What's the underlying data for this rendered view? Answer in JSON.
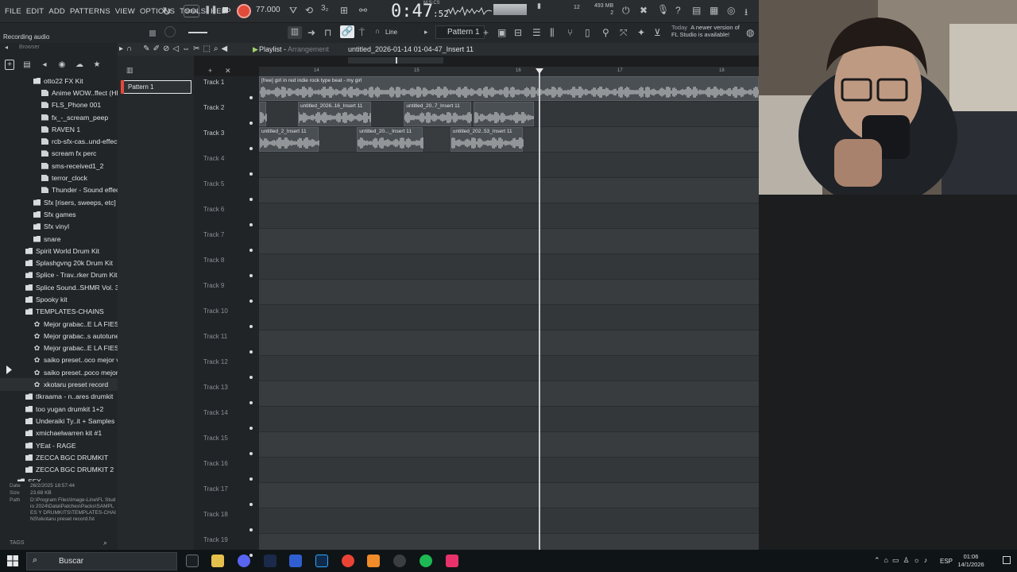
{
  "menu": [
    "FILE",
    "EDIT",
    "ADD",
    "PATTERNS",
    "VIEW",
    "OPTIONS",
    "TOOLS",
    "HELP"
  ],
  "transport": {
    "song_label": "SONG",
    "bpm": "77.000",
    "time": "0:47",
    "time_sub": ":52",
    "time_unit": "M:S:CS"
  },
  "meters": {
    "cpu": "12",
    "memory": "493 MB",
    "memory_sub": "2"
  },
  "toolbar": {
    "recording_label": "Recording audio",
    "snap_label": "Line",
    "pattern_select": "Pattern 1"
  },
  "news": {
    "prefix": "Today",
    "text_line1": "A newer version of",
    "text_line2": "FL Studio is available!"
  },
  "browser": {
    "header": "Browser",
    "items": [
      {
        "label": "otto22 FX Kit",
        "type": "folder",
        "indent": 2
      },
      {
        "label": "Anime WOW..ffect (HD)",
        "type": "file",
        "indent": 3
      },
      {
        "label": "FLS_Phone 001",
        "type": "file",
        "indent": 3
      },
      {
        "label": "fx_-_scream_peep",
        "type": "file",
        "indent": 3
      },
      {
        "label": "RAVEN 1",
        "type": "file",
        "indent": 3
      },
      {
        "label": "rcb-sfx-cas..und-effects",
        "type": "file",
        "indent": 3
      },
      {
        "label": "scream fx perc",
        "type": "file",
        "indent": 3
      },
      {
        "label": "sms-received1_2",
        "type": "file",
        "indent": 3
      },
      {
        "label": "terror_clock",
        "type": "file",
        "indent": 3
      },
      {
        "label": "Thunder - Sound effect",
        "type": "file",
        "indent": 3
      },
      {
        "label": "Sfx [risers, sweeps, etc]",
        "type": "folder",
        "indent": 2
      },
      {
        "label": "Sfx games",
        "type": "folder",
        "indent": 2
      },
      {
        "label": "Sfx vinyl",
        "type": "folder",
        "indent": 2
      },
      {
        "label": "snare",
        "type": "folder",
        "indent": 2
      },
      {
        "label": "Spirit World Drum Kit",
        "type": "folder",
        "indent": 1
      },
      {
        "label": "Splashgvng 20k Drum Kit",
        "type": "folder",
        "indent": 1
      },
      {
        "label": "Splice - Trav..rker Drum Kit",
        "type": "folder",
        "indent": 1
      },
      {
        "label": "Splice Sound..SHMR Vol. 3",
        "type": "folder",
        "indent": 1
      },
      {
        "label": "Spooky kit",
        "type": "folder",
        "indent": 1
      },
      {
        "label": "TEMPLATES-CHAINS",
        "type": "folder",
        "indent": 1
      },
      {
        "label": "Mejor grabac..E LA FIESTA",
        "type": "gear",
        "indent": 2
      },
      {
        "label": "Mejor grabac..s autotune)",
        "type": "gear",
        "indent": 2
      },
      {
        "label": "Mejor grabac..E LA FIESTA",
        "type": "gear",
        "indent": 2
      },
      {
        "label": "saiko preset..oco mejor v2",
        "type": "gear",
        "indent": 2
      },
      {
        "label": "saiko preset..poco mejor",
        "type": "gear",
        "indent": 2
      },
      {
        "label": "xkotaru preset record",
        "type": "gear",
        "indent": 2,
        "selected": true
      },
      {
        "label": "tlkraama - n..ares drumkit",
        "type": "folder",
        "indent": 1
      },
      {
        "label": "too yugan drumkit 1+2",
        "type": "folder",
        "indent": 1
      },
      {
        "label": "Underaiki Ty..it + Samples",
        "type": "folder",
        "indent": 1
      },
      {
        "label": "xmichaelwarren kit #1",
        "type": "folder",
        "indent": 1
      },
      {
        "label": "YEat - RAGE",
        "type": "folder",
        "indent": 1
      },
      {
        "label": "ZECCA BGC DRUMKIT",
        "type": "folder",
        "indent": 1
      },
      {
        "label": "ZECCA BGC DRUMKIT 2",
        "type": "folder",
        "indent": 1
      },
      {
        "label": "SFX",
        "type": "folder",
        "indent": 0
      },
      {
        "label": "Shapes",
        "type": "folder",
        "indent": 0
      }
    ],
    "info": {
      "date_key": "Date",
      "date": "26/2/2025 18:57:44",
      "size_key": "Size",
      "size": "23.68 KB",
      "path_key": "Path",
      "path": "D:\\Program Files\\Image-Line\\FL Studio 2024\\Data\\Patches\\Packs\\SAMPLES Y DRUMKITS\\TEMPLATES-CHAINS\\xkotaru preset record.fst"
    },
    "tags_label": "TAGS"
  },
  "playlist": {
    "title": "Playlist",
    "subtitle": "Arrangement",
    "file": "untitled_2026-01-14 01-04-47_Insert 11",
    "pattern": "Pattern 1",
    "ruler": [
      "14",
      "15",
      "16",
      "17",
      "18"
    ],
    "tracks": [
      "Track 1",
      "Track 2",
      "Track 3",
      "Track 4",
      "Track 5",
      "Track 6",
      "Track 7",
      "Track 8",
      "Track 9",
      "Track 10",
      "Track 11",
      "Track 12",
      "Track 13",
      "Track 14",
      "Track 15",
      "Track 16",
      "Track 17",
      "Track 18",
      "Track 19"
    ],
    "clips": [
      {
        "track": 0,
        "start": 0.0,
        "end": 1.0,
        "label": "[free] girl in red  indie rock type beat - my girl"
      },
      {
        "track": 1,
        "start": 0.0,
        "end": 0.014,
        "label": ""
      },
      {
        "track": 1,
        "start": 0.078,
        "end": 0.224,
        "label": "untitled_2026..16_Insert 11"
      },
      {
        "track": 1,
        "start": 0.29,
        "end": 0.425,
        "label": "untitled_20..7_Insert 11"
      },
      {
        "track": 1,
        "start": 0.43,
        "end": 0.55,
        "label": ""
      },
      {
        "track": 2,
        "start": 0.0,
        "end": 0.12,
        "label": "untitled_2_Insert 11"
      },
      {
        "track": 2,
        "start": 0.196,
        "end": 0.327,
        "label": "untitled_20..._Insert 11"
      },
      {
        "track": 2,
        "start": 0.383,
        "end": 0.528,
        "label": "untitled_202..53_Insert 11"
      }
    ],
    "playhead": 0.56
  },
  "taskbar": {
    "search_placeholder": "Buscar",
    "lang": "ESP",
    "time": "01:06",
    "date": "14/1/2026"
  },
  "colors": {
    "accent_red": "#e24a3a",
    "bg": "#1b1d1f",
    "grid": "#383c3f"
  }
}
